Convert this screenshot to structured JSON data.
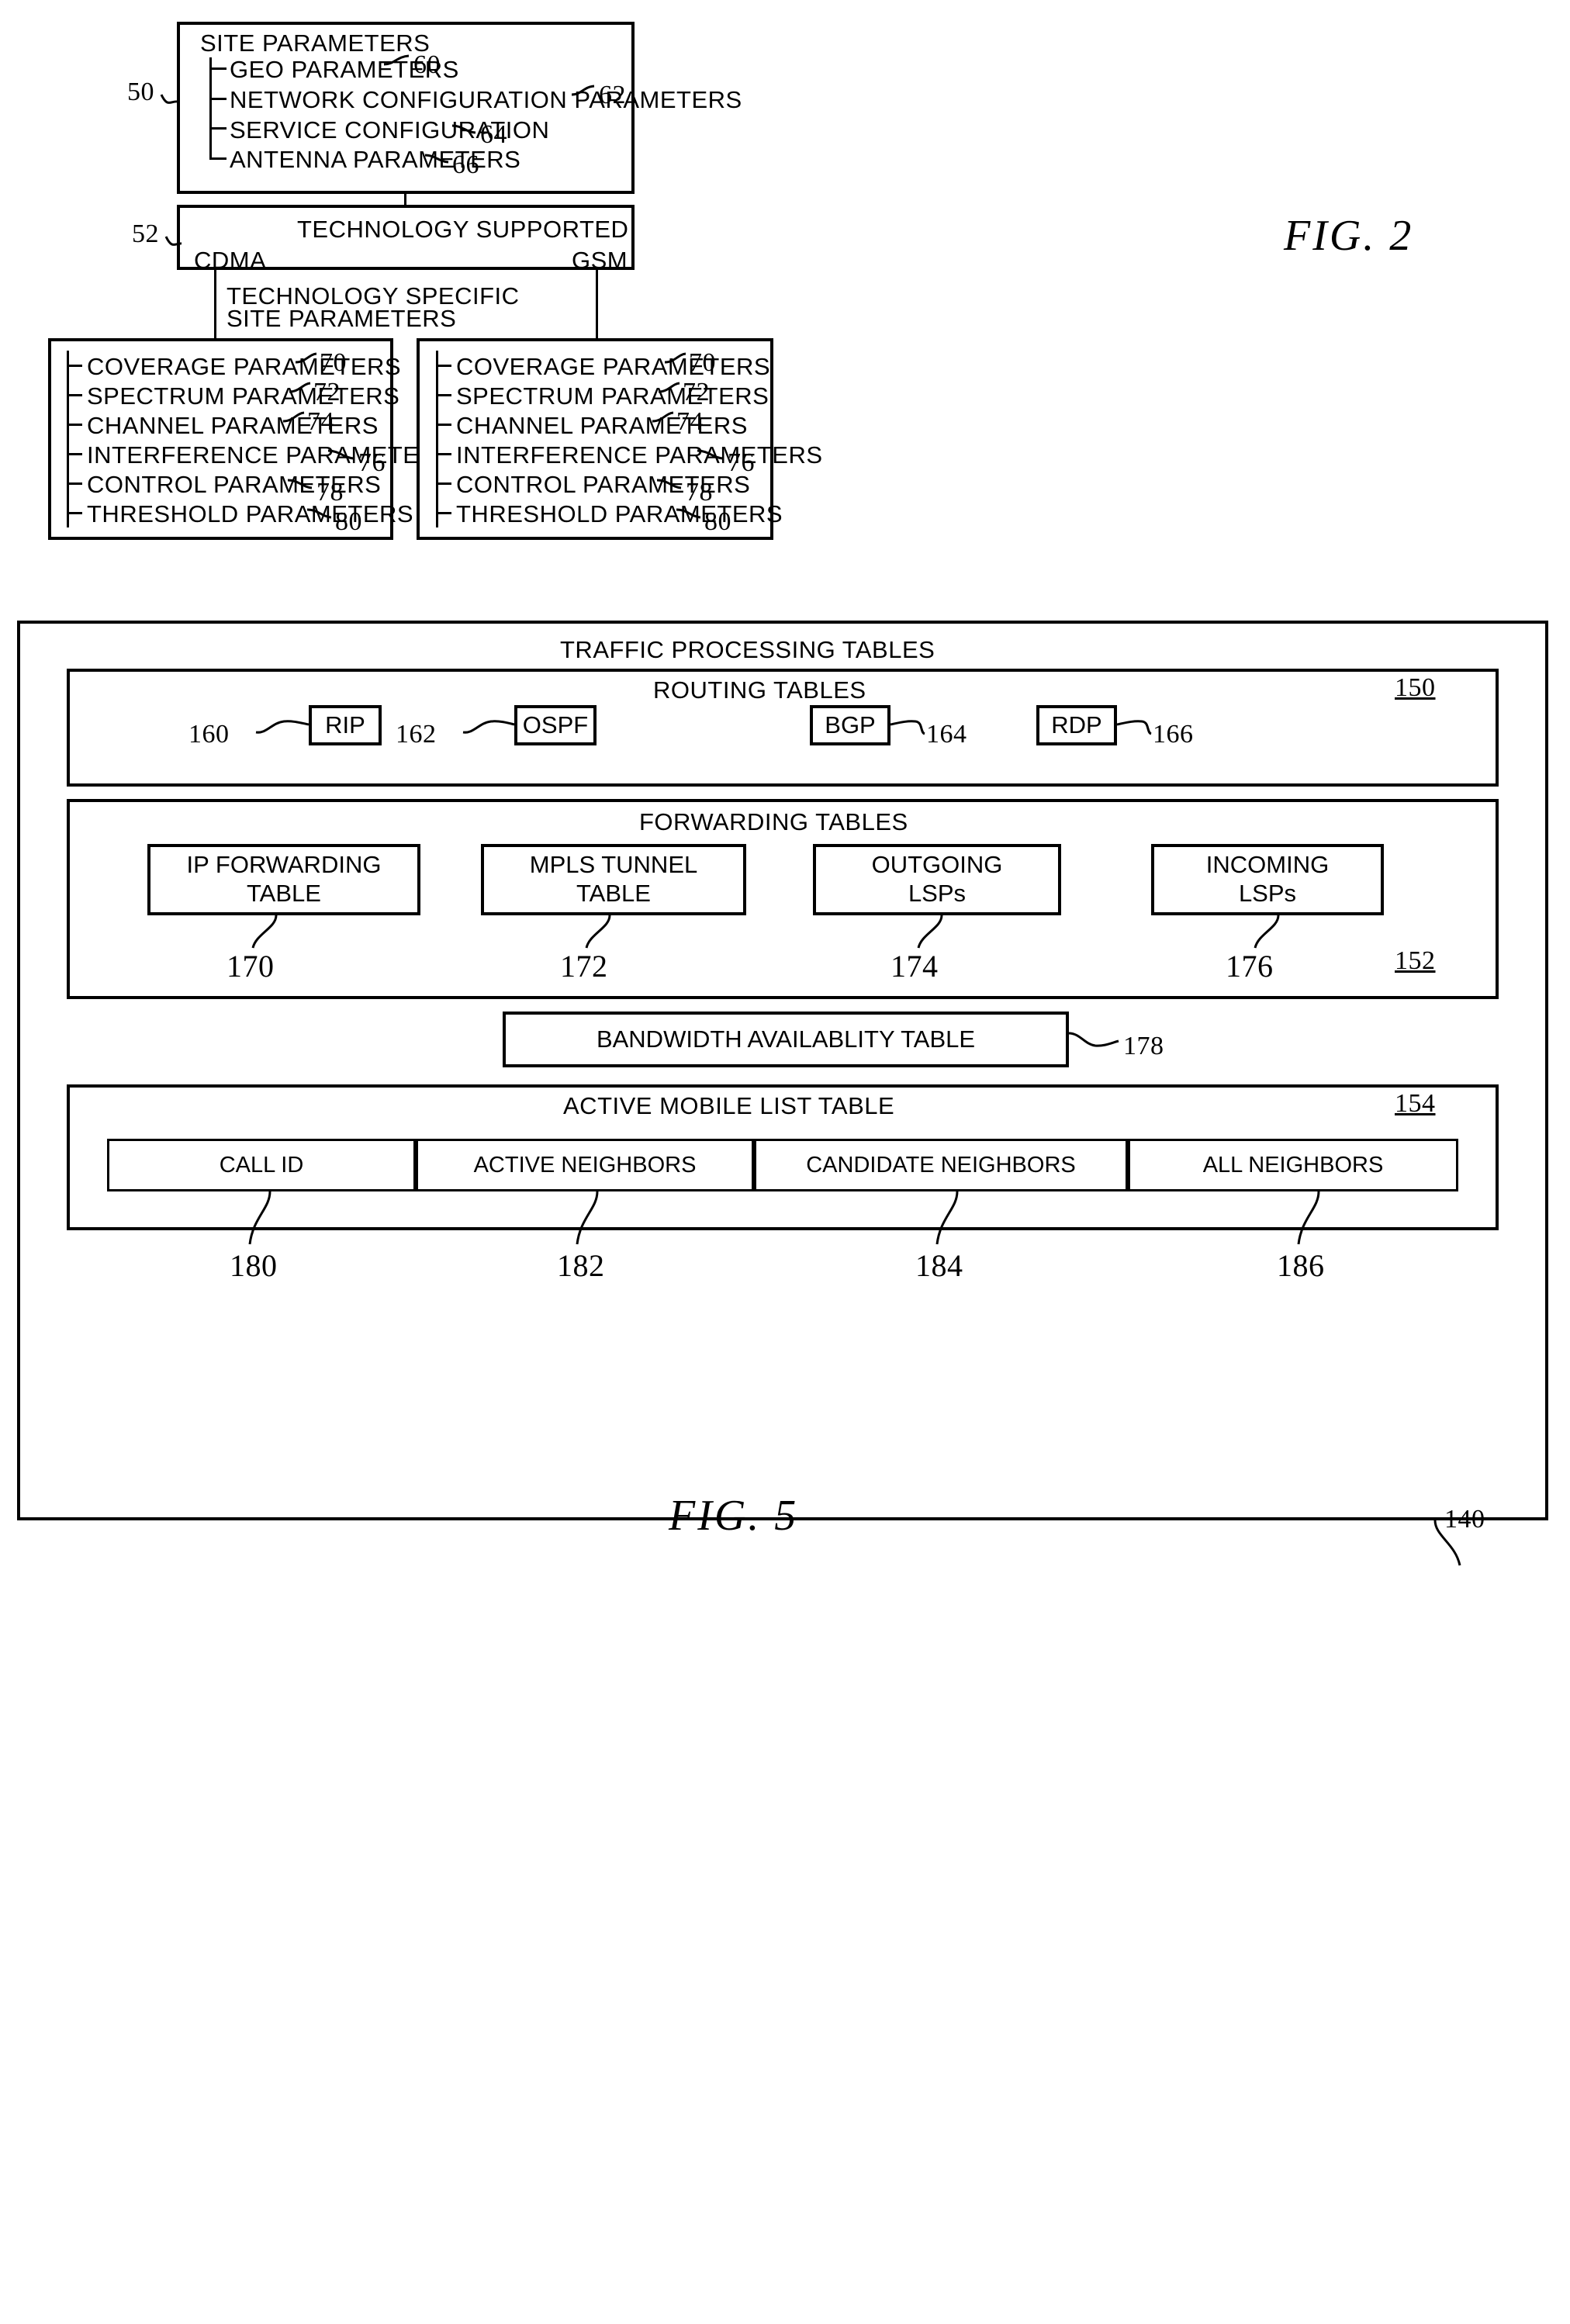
{
  "figures": {
    "fig2": {
      "caption": "FIG. 2",
      "site_parameters": {
        "ref": "50",
        "title": "SITE PARAMETERS",
        "items": [
          {
            "label": "GEO PARAMETERS",
            "ref": "60"
          },
          {
            "label": "NETWORK CONFIGURATION PARAMETERS",
            "ref": "62"
          },
          {
            "label": "SERVICE CONFIGURATION",
            "ref": "64"
          },
          {
            "label": "ANTENNA PARAMETERS",
            "ref": "66"
          }
        ]
      },
      "technology_supported": {
        "ref": "52",
        "title": "TECHNOLOGY SUPPORTED",
        "left_branch": "CDMA",
        "right_branch": "GSM"
      },
      "branch_note": [
        "TECHNOLOGY SPECIFIC",
        "SITE PARAMETERS"
      ],
      "tech_specific_items": [
        {
          "label": "COVERAGE PARAMETERS",
          "ref": "70"
        },
        {
          "label": "SPECTRUM PARAMETERS",
          "ref": "72"
        },
        {
          "label": "CHANNEL PARAMETERS",
          "ref": "74"
        },
        {
          "label": "INTERFERENCE PARAMETERS",
          "ref": "76"
        },
        {
          "label": "CONTROL PARAMETERS",
          "ref": "78"
        },
        {
          "label": "THRESHOLD PARAMETERS",
          "ref": "80"
        }
      ]
    },
    "fig5": {
      "caption": "FIG. 5",
      "outer_ref": "140",
      "title": "TRAFFIC PROCESSING TABLES",
      "routing": {
        "title": "ROUTING TABLES",
        "ref": "150",
        "protocols": [
          {
            "label": "RIP",
            "ref": "160",
            "ref_side": "left"
          },
          {
            "label": "OSPF",
            "ref": "162",
            "ref_side": "left"
          },
          {
            "label": "BGP",
            "ref": "164",
            "ref_side": "right"
          },
          {
            "label": "RDP",
            "ref": "166",
            "ref_side": "right"
          }
        ]
      },
      "forwarding": {
        "title": "FORWARDING TABLES",
        "ref": "152",
        "tables": [
          {
            "line1": "IP FORWARDING",
            "line2": "TABLE",
            "ref": "170"
          },
          {
            "line1": "MPLS TUNNEL",
            "line2": "TABLE",
            "ref": "172"
          },
          {
            "line1": "OUTGOING",
            "line2": "LSPs",
            "ref": "174"
          },
          {
            "line1": "INCOMING",
            "line2": "LSPs",
            "ref": "176"
          }
        ],
        "bandwidth": {
          "label": "BANDWIDTH AVAILABLITY TABLE",
          "ref": "178"
        }
      },
      "active_mobile": {
        "title": "ACTIVE MOBILE LIST TABLE",
        "ref": "154",
        "columns": [
          {
            "label": "CALL ID",
            "ref": "180"
          },
          {
            "label": "ACTIVE NEIGHBORS",
            "ref": "182"
          },
          {
            "label": "CANDIDATE NEIGHBORS",
            "ref": "184"
          },
          {
            "label": "ALL NEIGHBORS",
            "ref": "186"
          }
        ]
      }
    }
  }
}
